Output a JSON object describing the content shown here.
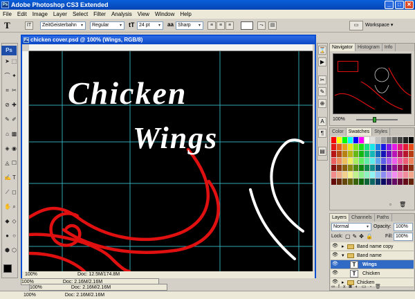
{
  "app": {
    "title": "Adobe Photoshop CS3 Extended",
    "logo": "Ps",
    "min": "_",
    "max": "□",
    "close": "✕"
  },
  "menu": [
    "File",
    "Edit",
    "Image",
    "Layer",
    "Select",
    "Filter",
    "Analysis",
    "View",
    "Window",
    "Help"
  ],
  "options": {
    "tool_glyph": "T",
    "font_family": "ZeitGeisterbahn",
    "font_style": "Regular",
    "font_size": "24 pt",
    "antialias": "Sharp",
    "workspace": "Workspace ▾"
  },
  "document": {
    "title": "chicken cover.psd @ 100% (Wings, RGB/8)",
    "zoom": "100%",
    "doc_size": "Doc: 12.5M/174.8M",
    "canvas_text_1": "Chicken",
    "canvas_text_2": "Wings"
  },
  "back_docs": [
    {
      "zoom": "100%",
      "doc_size": "Doc: 2.16M/2.16M"
    },
    {
      "zoom": "100%",
      "doc_size": "Doc: 2.16M/2.16M"
    },
    {
      "zoom": "100%",
      "doc_size": "Doc: 2.16M/2.16M"
    }
  ],
  "navigator": {
    "tabs": [
      "Navigator",
      "Histogram",
      "Info"
    ],
    "zoom": "100%"
  },
  "swatches": {
    "tabs": [
      "Color",
      "Swatches",
      "Styles"
    ]
  },
  "layers": {
    "tabs": [
      "Layers",
      "Channels",
      "Paths"
    ],
    "blend_mode": "Normal",
    "opacity_label": "Opacity:",
    "opacity": "100%",
    "lock_label": "Lock:",
    "fill_label": "Fill:",
    "fill": "100%",
    "items": [
      {
        "name": "Band name copy",
        "type": "group"
      },
      {
        "name": "Band name",
        "type": "group"
      },
      {
        "name": "Wings",
        "type": "text",
        "selected": true
      },
      {
        "name": "Chicken",
        "type": "text"
      },
      {
        "name": "Chicken",
        "type": "group"
      }
    ]
  },
  "colors": {
    "accent_red": "#e01010",
    "guide_cyan": "#3ec6d6",
    "selection_blue": "#316ac5"
  }
}
